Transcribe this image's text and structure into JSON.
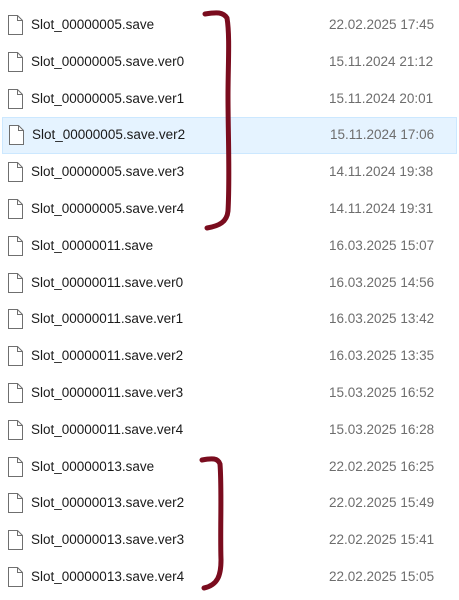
{
  "files": [
    {
      "name": "Slot_00000005.save",
      "date": "22.02.2025 17:45",
      "selected": false
    },
    {
      "name": "Slot_00000005.save.ver0",
      "date": "15.11.2024 21:12",
      "selected": false
    },
    {
      "name": "Slot_00000005.save.ver1",
      "date": "15.11.2024 20:01",
      "selected": false
    },
    {
      "name": "Slot_00000005.save.ver2",
      "date": "15.11.2024 17:06",
      "selected": true
    },
    {
      "name": "Slot_00000005.save.ver3",
      "date": "14.11.2024 19:38",
      "selected": false
    },
    {
      "name": "Slot_00000005.save.ver4",
      "date": "14.11.2024 19:31",
      "selected": false
    },
    {
      "name": "Slot_00000011.save",
      "date": "16.03.2025 15:07",
      "selected": false
    },
    {
      "name": "Slot_00000011.save.ver0",
      "date": "16.03.2025 14:56",
      "selected": false
    },
    {
      "name": "Slot_00000011.save.ver1",
      "date": "16.03.2025 13:42",
      "selected": false
    },
    {
      "name": "Slot_00000011.save.ver2",
      "date": "16.03.2025 13:35",
      "selected": false
    },
    {
      "name": "Slot_00000011.save.ver3",
      "date": "15.03.2025 16:52",
      "selected": false
    },
    {
      "name": "Slot_00000011.save.ver4",
      "date": "15.03.2025 16:28",
      "selected": false
    },
    {
      "name": "Slot_00000013.save",
      "date": "22.02.2025 16:25",
      "selected": false
    },
    {
      "name": "Slot_00000013.save.ver2",
      "date": "22.02.2025 15:49",
      "selected": false
    },
    {
      "name": "Slot_00000013.save.ver3",
      "date": "22.02.2025 15:41",
      "selected": false
    },
    {
      "name": "Slot_00000013.save.ver4",
      "date": "22.02.2025 15:05",
      "selected": false
    }
  ],
  "colors": {
    "selection_bg": "#e5f3ff",
    "selection_border": "#cce8ff",
    "name_text": "#1a1a1a",
    "date_text": "#6d6d6d",
    "bracket_annotation": "#7a0c1e"
  },
  "icons": {
    "file": "file-icon"
  }
}
